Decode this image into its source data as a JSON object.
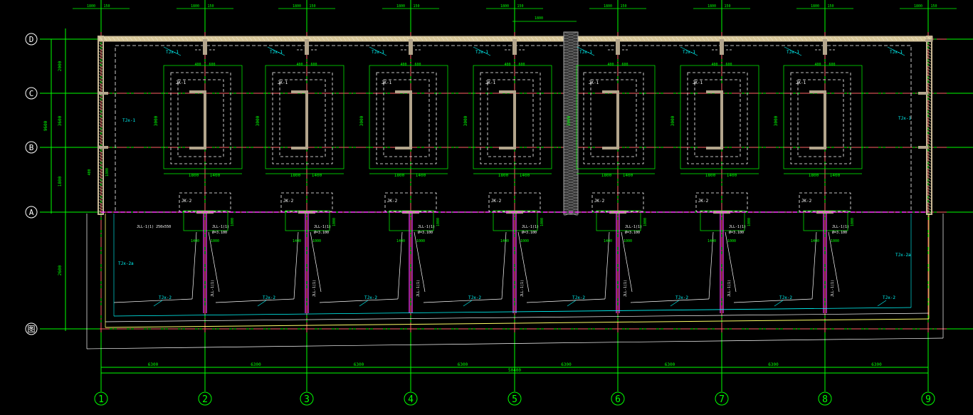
{
  "drawing": {
    "background": "#000000",
    "colors": {
      "grid_axis": "#ff6666",
      "dimension": "#00ff00",
      "wall": "#c9b896",
      "wall_hatch": "#d8c89a",
      "dashed_outline": "#ffffff",
      "cyan_label": "#00ffff",
      "magenta_line": "#ff33ff",
      "yellow_line": "#ffff66",
      "column": "#b3a58c",
      "hatch_band": "#888888"
    },
    "row_axes": [
      "D",
      "C",
      "B",
      "A",
      "图"
    ],
    "column_axes": [
      "1",
      "2",
      "3",
      "4",
      "5",
      "6",
      "7",
      "8",
      "9"
    ],
    "bay_dimensions": [
      "6300",
      "6300",
      "6300",
      "6300",
      "6300",
      "6300",
      "6300",
      "6300"
    ],
    "total_dimension": "50400",
    "left_dimensions": [
      "2000",
      "3600",
      "1800",
      "9600",
      "2600"
    ],
    "top_dims": [
      "1800",
      "150"
    ],
    "slab_label": "TJx-1",
    "slab_label_2": "TJx-2",
    "slab_label_2a": "TJx-2a",
    "pit_label": "JK-1",
    "pit_label_2": "JK-2",
    "beam_tag_1": "JLL-1(1) 250x550",
    "beam_tag_2": "JLL-1(1)",
    "beam_tag_3": "Ø=3.100",
    "pit_width_dims": [
      "1800",
      "1400"
    ],
    "pit_height_dims": [
      "3000",
      "1800"
    ],
    "small_pit_dims": [
      "1400",
      "1000",
      "1000"
    ],
    "short_dims": [
      "400",
      "600"
    ]
  }
}
